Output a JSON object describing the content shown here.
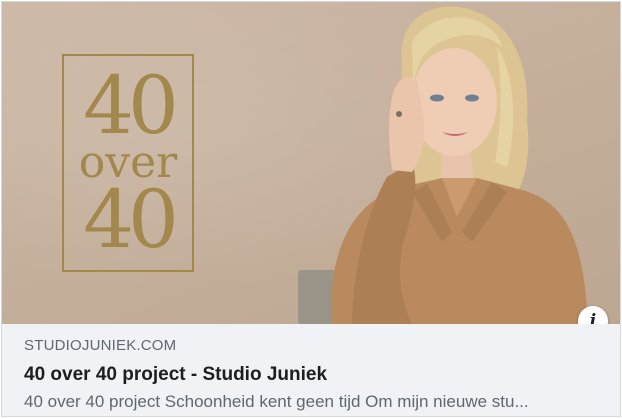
{
  "preview": {
    "logo": {
      "line1": "40",
      "line2": "over",
      "line3": "40"
    },
    "info_icon": "info-icon"
  },
  "link": {
    "domain": "STUDIOJUNIEK.COM",
    "title": "40 over 40 project - Studio Juniek",
    "description": "40 over 40 project Schoonheid kent geen tijd Om mijn nieuwe stu..."
  },
  "colors": {
    "background": "#c9b5a2",
    "logo_gold": "#a3884d",
    "blouse": "#b88a5e",
    "hair": "#e3cf9e"
  }
}
